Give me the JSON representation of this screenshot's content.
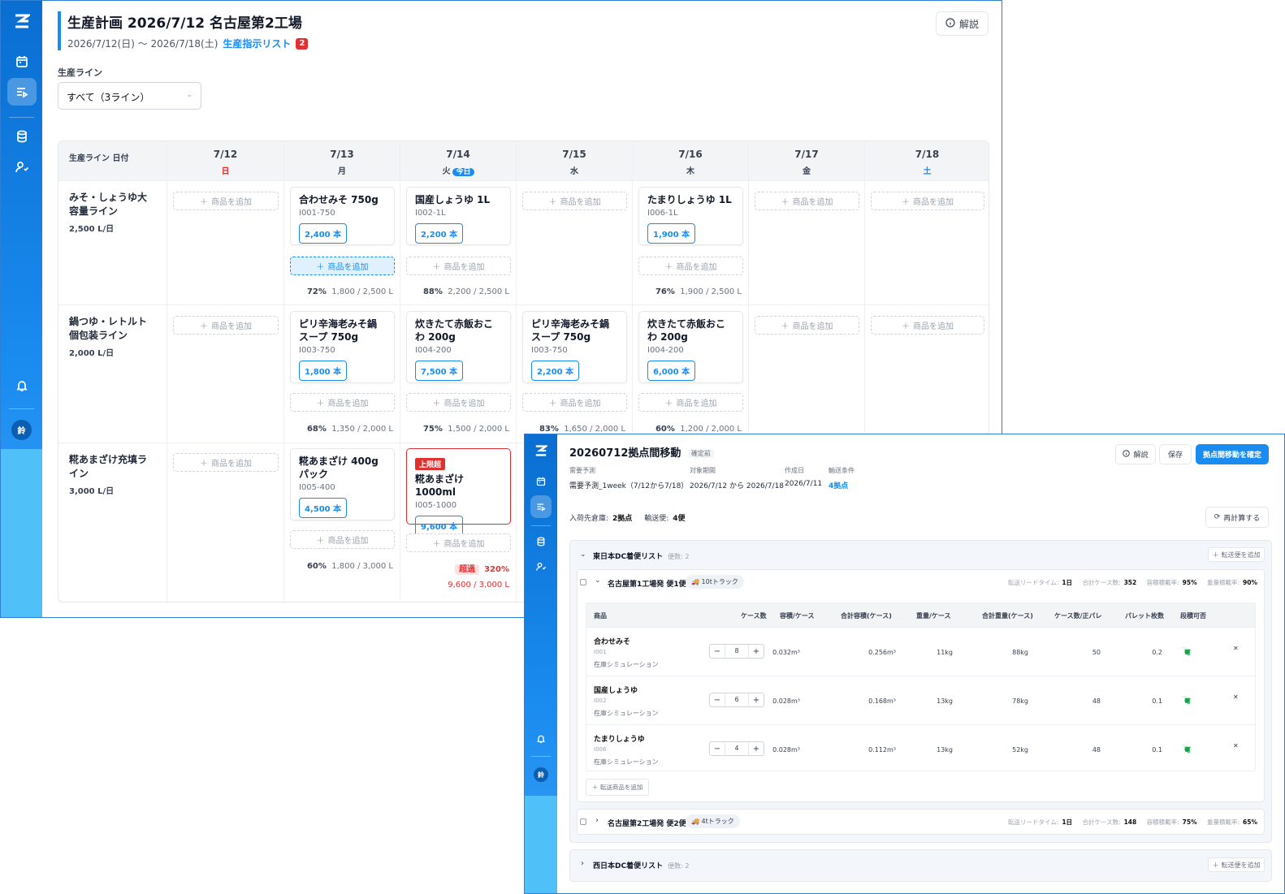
{
  "brand": {
    "accent": "#1a8cf0",
    "danger": "#e03131",
    "success": "#16a34a"
  },
  "sidebar": {
    "icons": [
      "logo-icon",
      "calendar-icon",
      "production-list-icon",
      "database-icon",
      "user-settings-icon",
      "bell-icon"
    ],
    "avatar_initial": "鈴"
  },
  "plan": {
    "title": "生産計画 2026/7/12 名古屋第2工場",
    "period": "2026/7/12(日) 〜 2026/7/18(土)",
    "instruction_link": "生産指示リスト",
    "instruction_count": "2",
    "help_label": "解説",
    "line_filter_label": "生産ライン",
    "line_filter_value": "すべて（3ライン）",
    "corner_header": "生産ライン 日付",
    "add_label": "商品を追加",
    "today_label": "今日",
    "days": [
      {
        "date": "7/12",
        "dow": "日",
        "color": "#e03131"
      },
      {
        "date": "7/13",
        "dow": "月",
        "color": "#374151"
      },
      {
        "date": "7/14",
        "dow": "火",
        "color": "#374151"
      },
      {
        "date": "7/15",
        "dow": "水",
        "color": "#374151"
      },
      {
        "date": "7/16",
        "dow": "木",
        "color": "#374151"
      },
      {
        "date": "7/17",
        "dow": "金",
        "color": "#374151"
      },
      {
        "date": "7/18",
        "dow": "土",
        "color": "#1a8cf0"
      }
    ],
    "lines": [
      {
        "name": "みそ・しょうゆ大容量ライン",
        "capacity": "2,500 L/日"
      },
      {
        "name": "鍋つゆ・レトルト個包装ライン",
        "capacity": "2,000 L/日"
      },
      {
        "name": "糀あまざけ充填ライン",
        "capacity": "3,000 L/日"
      }
    ],
    "cards": [
      {
        "name": "合わせみそ 750g",
        "code": "I001-750",
        "qty": "2,400 本"
      },
      {
        "name": "国産しょうゆ 1L",
        "code": "I002-1L",
        "qty": "2,200 本"
      },
      {
        "name": "たまりしょうゆ 1L",
        "code": "I006-1L",
        "qty": "1,900 本"
      },
      {
        "name": "ピリ辛海老みそ鍋スープ 750g",
        "code": "I003-750",
        "qty": "1,800 本"
      },
      {
        "name": "炊きたて赤飯おこわ 200g",
        "code": "I004-200",
        "qty": "7,500 本"
      },
      {
        "name": "ピリ辛海老みそ鍋スープ 750g",
        "code": "I003-750",
        "qty": "2,200 本"
      },
      {
        "name": "炊きたて赤飯おこわ 200g",
        "code": "I004-200",
        "qty": "6,000 本"
      },
      {
        "name": "糀あまざけ 400gパック",
        "code": "I005-400",
        "qty": "4,500 本"
      },
      {
        "name": "糀あまざけ 1000ml",
        "code": "I005-1000",
        "qty": "9,600 本",
        "tag": "上限超"
      }
    ],
    "utilization": [
      {
        "pct": "72%",
        "detail": "1,800 / 2,500 L"
      },
      {
        "pct": "88%",
        "detail": "2,200 / 2,500 L"
      },
      {
        "pct": "76%",
        "detail": "1,900 / 2,500 L"
      },
      {
        "pct": "68%",
        "detail": "1,350 / 2,000 L"
      },
      {
        "pct": "75%",
        "detail": "1,500 / 2,000 L"
      },
      {
        "pct": "83%",
        "detail": "1,650 / 2,000 L"
      },
      {
        "pct": "60%",
        "detail": "1,200 / 2,000 L"
      },
      {
        "pct": "60%",
        "detail": "1,800 / 3,000 L"
      },
      {
        "pct": "320%",
        "detail": "9,600 / 3,000 L",
        "over_label": "超過"
      }
    ]
  },
  "transfer": {
    "title": "20260712拠点間移動",
    "status": "確定前",
    "help_label": "解説",
    "save_label": "保存",
    "confirm_label": "拠点間移動を確定",
    "meta": [
      {
        "label": "需要予測",
        "value": "需要予測_1week（7/12から7/18）"
      },
      {
        "label": "対象期間",
        "value": "2026/7/12 から 2026/7/18"
      },
      {
        "label": "作成日",
        "value": "2026/7/11"
      },
      {
        "label": "輸送条件",
        "value": "4拠点"
      }
    ],
    "dest_label": "入荷先倉庫:",
    "dest_value": "2拠点",
    "trips_label": "輸送便:",
    "trips_value": "4便",
    "recalc_label": "再計算する",
    "add_trip_label": "転送便を追加",
    "add_item_label": "転送商品を追加",
    "groups": [
      {
        "name": "東日本DC着便リスト",
        "count": "便数: 2"
      },
      {
        "name": "西日本DC着便リスト",
        "count": "便数: 2"
      }
    ],
    "stat_labels": {
      "lead": "転送リードタイム:",
      "cases": "合計ケース数:",
      "vol": "容積積載率:",
      "wt": "重量積載率:"
    },
    "trips": [
      {
        "name": "名古屋第1工場発 便1便",
        "truck": "10tトラック",
        "lead": "1日",
        "cases": "352",
        "vol": "95%",
        "wt": "90%"
      },
      {
        "name": "名古屋第2工場発 便2便",
        "truck": "4tトラック",
        "lead": "1日",
        "cases": "148",
        "vol": "75%",
        "wt": "65%"
      }
    ],
    "columns": [
      "商品",
      "ケース数",
      "容積/ケース",
      "合計容積(ケース)",
      "重量/ケース",
      "合計重量(ケース)",
      "ケース数/正パレ",
      "パレット枚数",
      "段積可否"
    ],
    "sim_label": "在庫シミュレーション",
    "ok_label": "可",
    "rows": [
      {
        "name": "合わせみそ",
        "code": "I001",
        "qty": "8",
        "vol": "0.032m³",
        "tvol": "0.256m³",
        "wt": "11kg",
        "twt": "88kg",
        "per": "50",
        "pal": "0.2"
      },
      {
        "name": "国産しょうゆ",
        "code": "I002",
        "qty": "6",
        "vol": "0.028m³",
        "tvol": "0.168m³",
        "wt": "13kg",
        "twt": "78kg",
        "per": "48",
        "pal": "0.1"
      },
      {
        "name": "たまりしょうゆ",
        "code": "I006",
        "qty": "4",
        "vol": "0.028m³",
        "tvol": "0.112m³",
        "wt": "13kg",
        "twt": "52kg",
        "per": "48",
        "pal": "0.1"
      }
    ]
  }
}
